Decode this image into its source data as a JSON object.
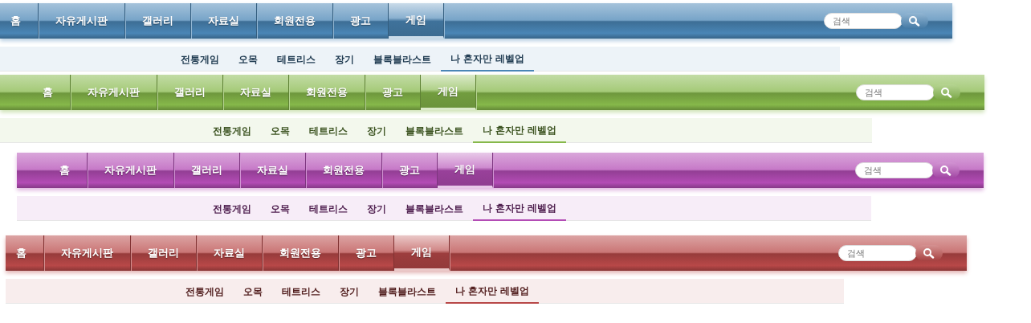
{
  "menus": [
    {
      "color": "#4a86b6",
      "items": [
        {
          "label": "홈",
          "selected": false
        },
        {
          "label": "자유게시판",
          "selected": false
        },
        {
          "label": "갤러리",
          "selected": false
        },
        {
          "label": "자료실",
          "selected": false
        },
        {
          "label": "회원전용",
          "selected": false
        },
        {
          "label": "광고",
          "selected": false
        },
        {
          "label": "게임",
          "selected": true
        }
      ],
      "search": {
        "placeholder": "검색"
      },
      "submenu": [
        {
          "label": "전통게임",
          "selected": false
        },
        {
          "label": "오목",
          "selected": false
        },
        {
          "label": "테트리스",
          "selected": false
        },
        {
          "label": "장기",
          "selected": false
        },
        {
          "label": "블록블라스트",
          "selected": false
        },
        {
          "label": "나 혼자만 레벨업",
          "selected": true
        }
      ]
    },
    {
      "color": "#86b84a",
      "items": [
        {
          "label": "홈",
          "selected": false
        },
        {
          "label": "자유게시판",
          "selected": false
        },
        {
          "label": "갤러리",
          "selected": false
        },
        {
          "label": "자료실",
          "selected": false
        },
        {
          "label": "회원전용",
          "selected": false
        },
        {
          "label": "광고",
          "selected": false
        },
        {
          "label": "게임",
          "selected": true
        }
      ],
      "search": {
        "placeholder": "검색"
      },
      "submenu": [
        {
          "label": "전통게임",
          "selected": false
        },
        {
          "label": "오목",
          "selected": false
        },
        {
          "label": "테트리스",
          "selected": false
        },
        {
          "label": "장기",
          "selected": false
        },
        {
          "label": "블록블라스트",
          "selected": false
        },
        {
          "label": "나 혼자만 레벨업",
          "selected": true
        }
      ]
    },
    {
      "color": "#b34cb5",
      "items": [
        {
          "label": "홈",
          "selected": false
        },
        {
          "label": "자유게시판",
          "selected": false
        },
        {
          "label": "갤러리",
          "selected": false
        },
        {
          "label": "자료실",
          "selected": false
        },
        {
          "label": "회원전용",
          "selected": false
        },
        {
          "label": "광고",
          "selected": false
        },
        {
          "label": "게임",
          "selected": true
        }
      ],
      "search": {
        "placeholder": "검색"
      },
      "submenu": [
        {
          "label": "전통게임",
          "selected": false
        },
        {
          "label": "오목",
          "selected": false
        },
        {
          "label": "테트리스",
          "selected": false
        },
        {
          "label": "장기",
          "selected": false
        },
        {
          "label": "블록블라스트",
          "selected": false
        },
        {
          "label": "나 혼자만 레벨업",
          "selected": true
        }
      ]
    },
    {
      "color": "#b84848",
      "items": [
        {
          "label": "홈",
          "selected": false
        },
        {
          "label": "자유게시판",
          "selected": false
        },
        {
          "label": "갤러리",
          "selected": false
        },
        {
          "label": "자료실",
          "selected": false
        },
        {
          "label": "회원전용",
          "selected": false
        },
        {
          "label": "광고",
          "selected": false
        },
        {
          "label": "게임",
          "selected": true
        }
      ],
      "search": {
        "placeholder": "검색"
      },
      "submenu": [
        {
          "label": "전통게임",
          "selected": false
        },
        {
          "label": "오목",
          "selected": false
        },
        {
          "label": "테트리스",
          "selected": false
        },
        {
          "label": "장기",
          "selected": false
        },
        {
          "label": "블록블라스트",
          "selected": false
        },
        {
          "label": "나 혼자만 레벨업",
          "selected": true
        }
      ]
    }
  ]
}
